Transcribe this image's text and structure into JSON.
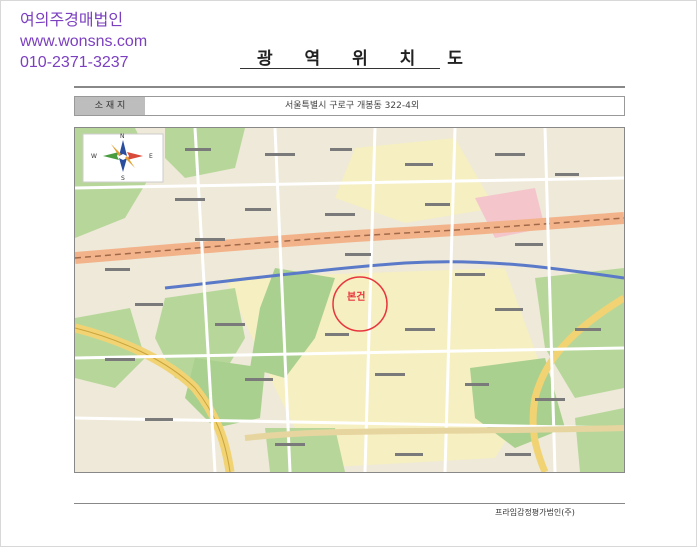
{
  "watermark": {
    "company": "여의주경매법인",
    "website": "www.wonsns.com",
    "phone": "010-2371-3237"
  },
  "document": {
    "title": "광 역 위 치 도",
    "address_label": "소 재 지",
    "address_value": "서울특별시 구로구 개봉동 322-4외",
    "footer": "프라임감정평가법인(주)"
  },
  "map": {
    "compass": {
      "north": "N",
      "south": "S",
      "west": "W",
      "east": "E"
    },
    "subject_label": "본건",
    "colors": {
      "base": "#eee9d8",
      "green": "#a9d08e",
      "urban": "#f6efc2",
      "rail": "#f3b38a",
      "rail_line": "#5a79c8",
      "expressway": "#f1d373",
      "marker": "#e8363d"
    }
  }
}
